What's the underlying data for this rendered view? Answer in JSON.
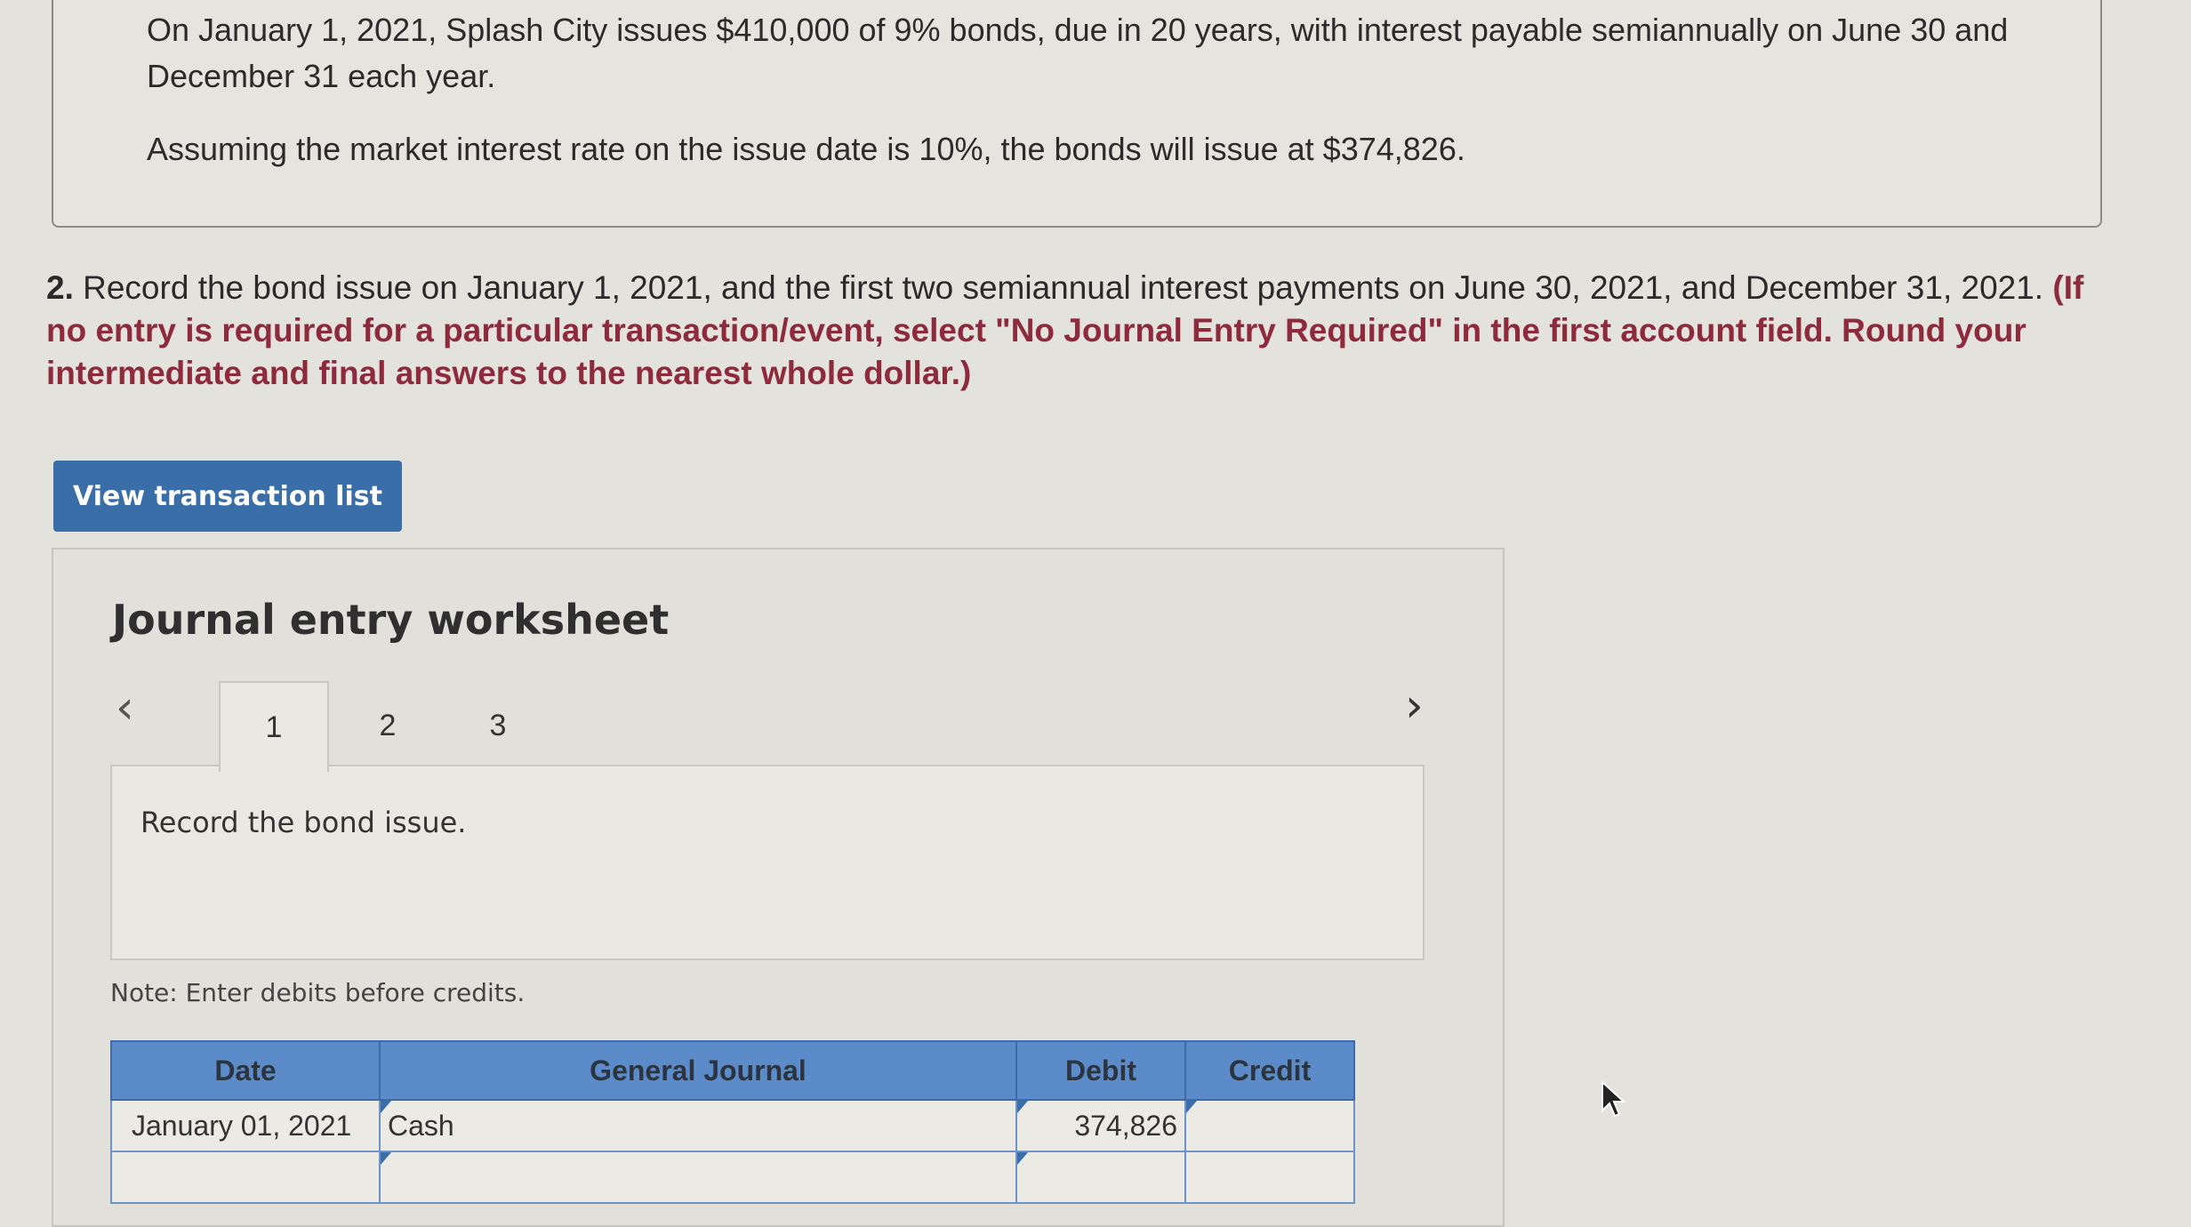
{
  "problem": {
    "line1": "On January 1, 2021, Splash City issues $410,000 of 9% bonds, due in 20 years, with interest payable semiannually on June 30 and December 31 each year.",
    "line2": "Assuming the market interest rate on the issue date is 10%, the bonds will issue at $374,826."
  },
  "question": {
    "number": "2.",
    "text": " Record the bond issue on January 1, 2021, and the first two semiannual interest payments on June 30, 2021, and December 31, 2021. ",
    "instruction": "(If no entry is required for a particular transaction/event, select \"No Journal Entry Required\" in the first account field. Round your intermediate and final answers to the nearest whole dollar.)"
  },
  "view_button": "View transaction list",
  "worksheet": {
    "title": "Journal entry worksheet",
    "tabs": [
      "1",
      "2",
      "3"
    ],
    "active_tab": "1",
    "description": "Record the bond issue.",
    "note": "Note: Enter debits before credits.",
    "table": {
      "headers": [
        "Date",
        "General Journal",
        "Debit",
        "Credit"
      ],
      "rows": [
        {
          "date": "January 01, 2021",
          "account": "Cash",
          "debit": "374,826",
          "credit": ""
        },
        {
          "date": "",
          "account": "",
          "debit": "",
          "credit": ""
        }
      ]
    }
  }
}
